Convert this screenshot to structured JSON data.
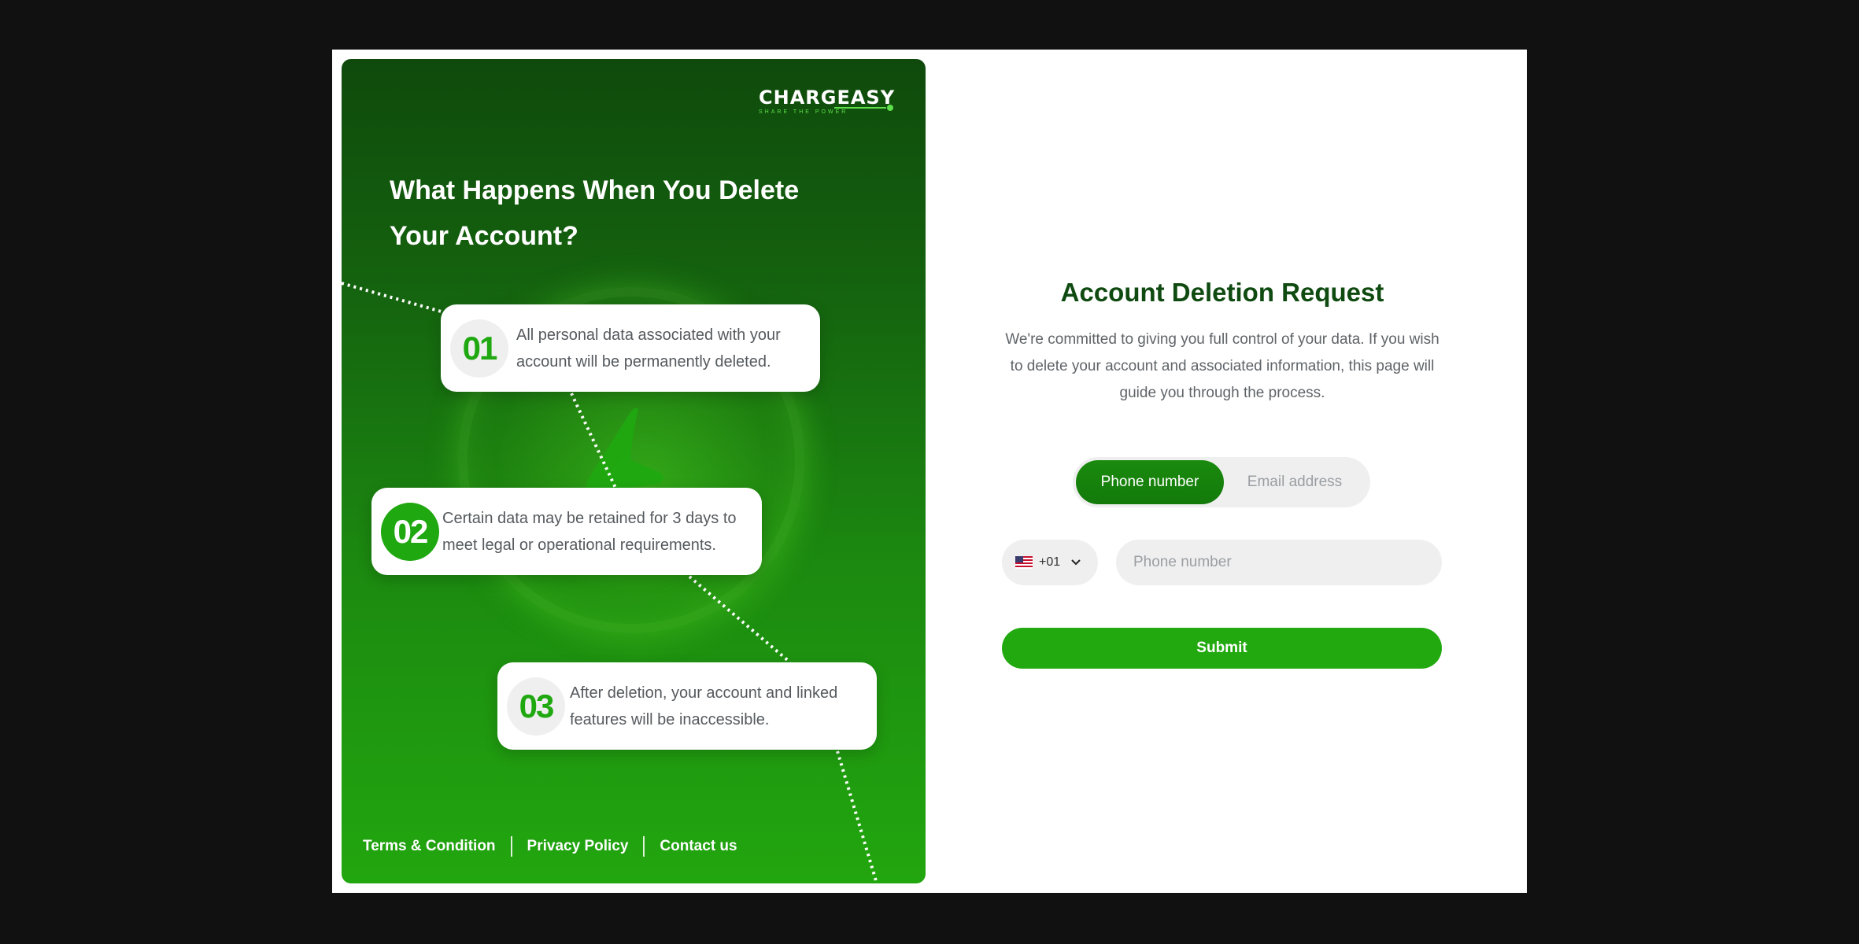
{
  "brand": {
    "logo_text": "CHARGEASY",
    "tagline": "SHARE THE POWER",
    "accent_color": "#22a90f",
    "dark_green": "#0f4a10"
  },
  "promo": {
    "title": "What Happens When You Delete Your Account?",
    "steps": [
      {
        "number": "01",
        "text": "All personal data associated with your account will be permanently deleted."
      },
      {
        "number": "02",
        "text": "Certain data may be retained for 3 days to meet legal or operational requirements."
      },
      {
        "number": "03",
        "text": "After deletion, your account and linked features will be inaccessible."
      }
    ],
    "footer_links": [
      "Terms & Condition",
      "Privacy Policy",
      "Contact us"
    ]
  },
  "form": {
    "title": "Account Deletion Request",
    "description": "We're committed to giving you full control of your data. If you wish to delete your account and associated information, this page will guide you through the process.",
    "toggle": {
      "active": "Phone number",
      "inactive": "Email address"
    },
    "country": {
      "flag_icon": "us-flag-icon",
      "dial_code": "+01"
    },
    "phone_placeholder": "Phone number",
    "submit_label": "Submit"
  }
}
